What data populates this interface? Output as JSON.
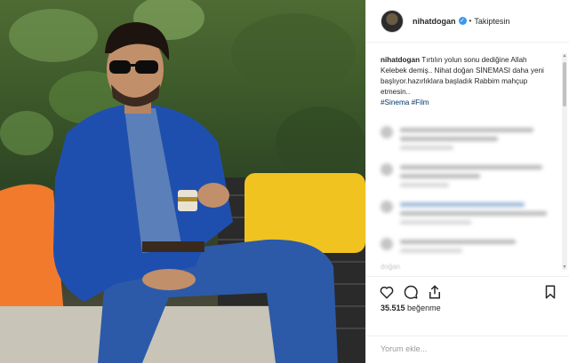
{
  "header": {
    "username": "nihatdogan",
    "verified_glyph": "✓",
    "separator": "•",
    "follow_label": "Takiptesin"
  },
  "caption": {
    "username": "nihatdogan",
    "text": "Tırtılın yolun sonu dediğine Allah Kelebek demiş.. Nihat doğan SİNEMASI daha yeni başlıyor.hazırlıklara başladık Rabbim mahçup etmesin..",
    "tags": [
      "#Sinema",
      "#Film"
    ]
  },
  "faded_text": "doğan",
  "scrollbar": {
    "up": "▲",
    "down": "▼"
  },
  "likes": {
    "count": "35.515",
    "label": "beğenme"
  },
  "comment": {
    "placeholder": "Yorum ekle..."
  },
  "icons": {
    "heart": "heart-icon",
    "comment": "comment-icon",
    "share": "share-icon",
    "save": "bookmark-icon"
  }
}
